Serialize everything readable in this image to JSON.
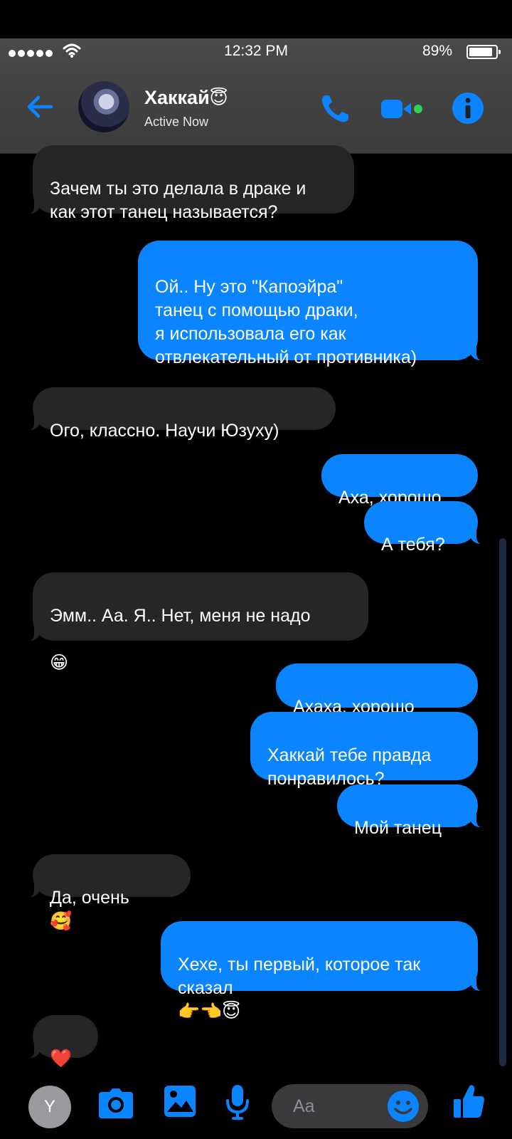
{
  "status_bar": {
    "time": "12:32 PM",
    "battery": "89%"
  },
  "header": {
    "contact_name": "Хаккай",
    "contact_emoji": "😇",
    "contact_status": "Active Now"
  },
  "messages": [
    {
      "side": "received",
      "text": "Зачем ты это делала в драке и\nкак этот танец называется?"
    },
    {
      "side": "sent",
      "text": "Ой.. Ну это \"Капоэйра\"\nтанец с помощью драки,\nя использовала его как\nотвлекательный от противника)"
    },
    {
      "side": "received",
      "text": "Ого, классно. Научи Юзуху)"
    },
    {
      "side": "sent",
      "text": "Аха, хорошо"
    },
    {
      "side": "sent",
      "text": "А тебя?"
    },
    {
      "side": "received",
      "text": "Эмм.. Аа. Я.. Нет, меня не надо",
      "emoji": "😁"
    },
    {
      "side": "sent",
      "text": "Ахаха, хорошо",
      "emoji": "🥰"
    },
    {
      "side": "sent",
      "text": "Хаккай тебе правда\nпонравилось?"
    },
    {
      "side": "sent",
      "text": "Мой танец"
    },
    {
      "side": "received",
      "text": "Да, очень",
      "emoji": "🥰"
    },
    {
      "side": "sent",
      "text": "Хехе, ты первый, которое так\nсказал",
      "emoji": "👉👈😇"
    },
    {
      "side": "received",
      "text": "",
      "emoji": "❤️"
    }
  ],
  "composer": {
    "user_initial": "Y",
    "placeholder": "Aa"
  },
  "colors": {
    "accent": "#0a84ff",
    "received_bubble": "#262629",
    "header_bg": "#444444"
  },
  "icons": [
    "back-arrow-icon",
    "phone-icon",
    "video-camera-icon",
    "info-icon",
    "camera-icon",
    "image-icon",
    "microphone-icon",
    "emoji-icon",
    "thumbs-up-icon",
    "wifi-icon",
    "signal-icon",
    "battery-icon"
  ]
}
